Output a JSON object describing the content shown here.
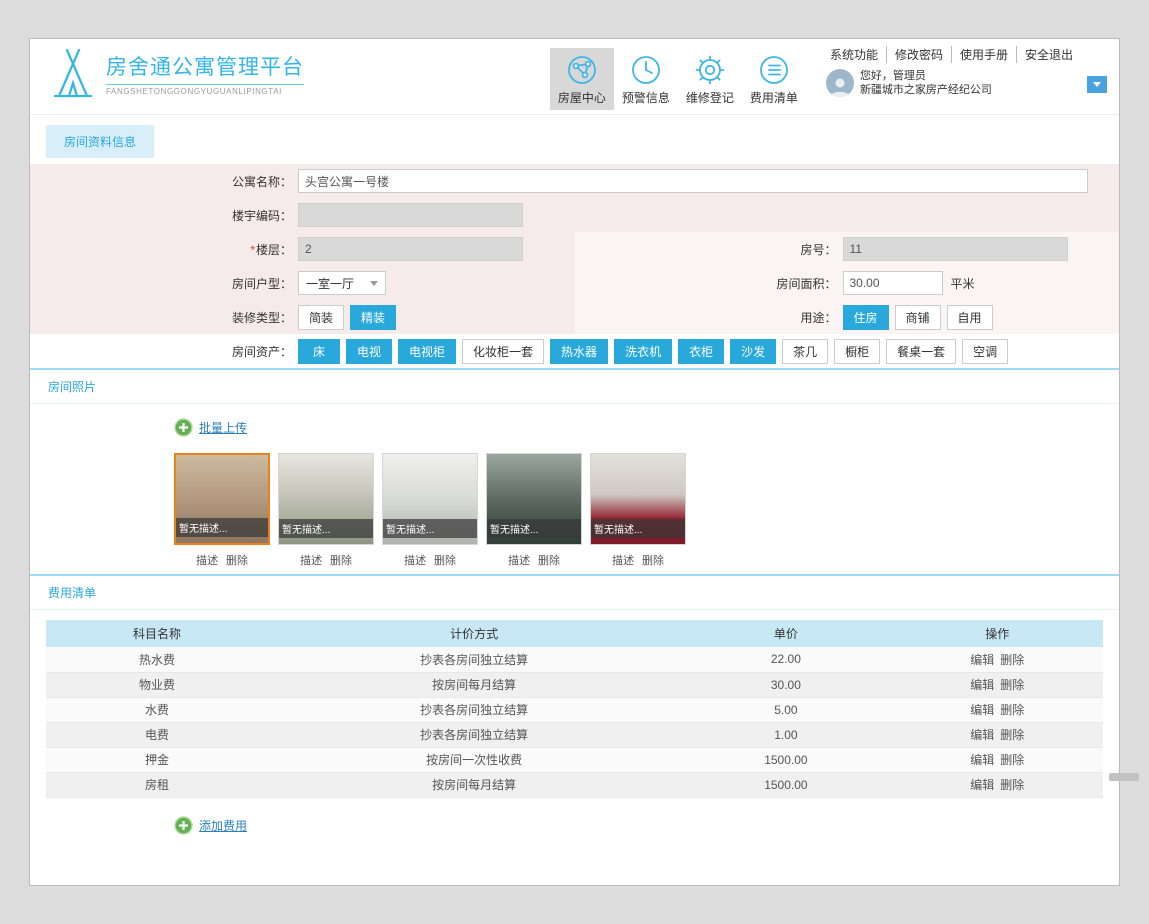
{
  "colors": {
    "primary_blue": "#29a8dc",
    "logo_blue": "#33b5e5",
    "form_pink": "#f5ebeb",
    "table_header_blue": "#c9e8f5",
    "selected_photo_border": "#e8821e",
    "upload_green": "#62b152",
    "nav_active_gray": "#d8d8d8"
  },
  "header": {
    "logo_title": "房舍通公寓管理平台",
    "logo_subtitle": "FANGSHETONGGONGYUGUANLIPINGTAI",
    "top_links": [
      "系统功能",
      "修改密码",
      "使用手册",
      "安全退出"
    ],
    "nav_items": [
      {
        "label": "房屋中心",
        "active": true
      },
      {
        "label": "预警信息",
        "active": false
      },
      {
        "label": "维修登记",
        "active": false
      },
      {
        "label": "费用清单",
        "active": false
      }
    ],
    "user": {
      "greeting": "您好，管理员",
      "company": "新疆城市之家房产经纪公司"
    }
  },
  "tab": {
    "label": "房间资料信息"
  },
  "form": {
    "apartment_name_label": "公寓名称：",
    "apartment_name_value": "头宫公寓一号楼",
    "building_code_label": "楼宇编码：",
    "building_code_value": "",
    "required_mark": "*",
    "floor_label": "楼层：",
    "floor_value": "2",
    "room_no_label": "房号：",
    "room_no_value": "11",
    "layout_label": "房间户型：",
    "layout_value": "一室一厅",
    "area_label": "房间面积：",
    "area_value": "30.00",
    "area_unit": "平米",
    "decoration_label": "装修类型：",
    "decoration_options": [
      {
        "label": "简装",
        "selected": false
      },
      {
        "label": "精装",
        "selected": true
      }
    ],
    "usage_label": "用途：",
    "usage_options": [
      {
        "label": "住房",
        "selected": true
      },
      {
        "label": "商铺",
        "selected": false
      },
      {
        "label": "自用",
        "selected": false
      }
    ],
    "assets_label": "房间资产：",
    "assets": [
      {
        "label": "床",
        "selected": true
      },
      {
        "label": "电视",
        "selected": true
      },
      {
        "label": "电视柜",
        "selected": true
      },
      {
        "label": "化妆柜一套",
        "selected": false
      },
      {
        "label": "热水器",
        "selected": true
      },
      {
        "label": "洗衣机",
        "selected": true
      },
      {
        "label": "衣柜",
        "selected": true
      },
      {
        "label": "沙发",
        "selected": true
      },
      {
        "label": "茶几",
        "selected": false
      },
      {
        "label": "橱柜",
        "selected": false
      },
      {
        "label": "餐桌一套",
        "selected": false
      },
      {
        "label": "空调",
        "selected": false
      }
    ]
  },
  "photos": {
    "section_title": "房间照片",
    "upload_label": "批量上传",
    "describe_label": "描述",
    "delete_label": "删除",
    "items": [
      {
        "caption": "暂无描述...",
        "selected": true
      },
      {
        "caption": "暂无描述...",
        "selected": false
      },
      {
        "caption": "暂无描述...",
        "selected": false
      },
      {
        "caption": "暂无描述...",
        "selected": false
      },
      {
        "caption": "暂无描述...",
        "selected": false
      }
    ]
  },
  "fees": {
    "section_title": "费用清单",
    "columns": [
      "科目名称",
      "计价方式",
      "单价",
      "操作"
    ],
    "edit_label": "编辑",
    "delete_label": "删除",
    "add_label": "添加费用",
    "rows": [
      {
        "name": "热水费",
        "method": "抄表各房间独立结算",
        "price": "22.00"
      },
      {
        "name": "物业费",
        "method": "按房间每月结算",
        "price": "30.00"
      },
      {
        "name": "水费",
        "method": "抄表各房间独立结算",
        "price": "5.00"
      },
      {
        "name": "电费",
        "method": "抄表各房间独立结算",
        "price": "1.00"
      },
      {
        "name": "押金",
        "method": "按房间一次性收费",
        "price": "1500.00"
      },
      {
        "name": "房租",
        "method": "按房间每月结算",
        "price": "1500.00"
      }
    ]
  }
}
